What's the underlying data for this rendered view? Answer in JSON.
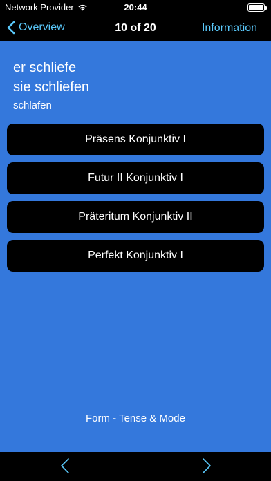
{
  "status_bar": {
    "carrier": "Network Provider",
    "time": "20:44"
  },
  "nav": {
    "back_label": "Overview",
    "title": "10 of 20",
    "info_label": "Information"
  },
  "prompt": {
    "lines": [
      "er schliefe",
      "sie schliefen"
    ],
    "infinitive": "schlafen"
  },
  "options": [
    "Präsens Konjunktiv I",
    "Futur II Konjunktiv I",
    "Präteritum Konjunktiv II",
    "Perfekt Konjunktiv I"
  ],
  "footer": {
    "label": "Form - Tense & Mode"
  },
  "colors": {
    "background": "#3478dc",
    "accent": "#5ac8fa",
    "option_background": "#000000"
  },
  "icons": {
    "status": [
      "wifi-icon",
      "battery-icon"
    ],
    "nav": [
      "chevron-left-icon"
    ],
    "toolbar": [
      "chevron-left-icon",
      "chevron-right-icon"
    ]
  }
}
